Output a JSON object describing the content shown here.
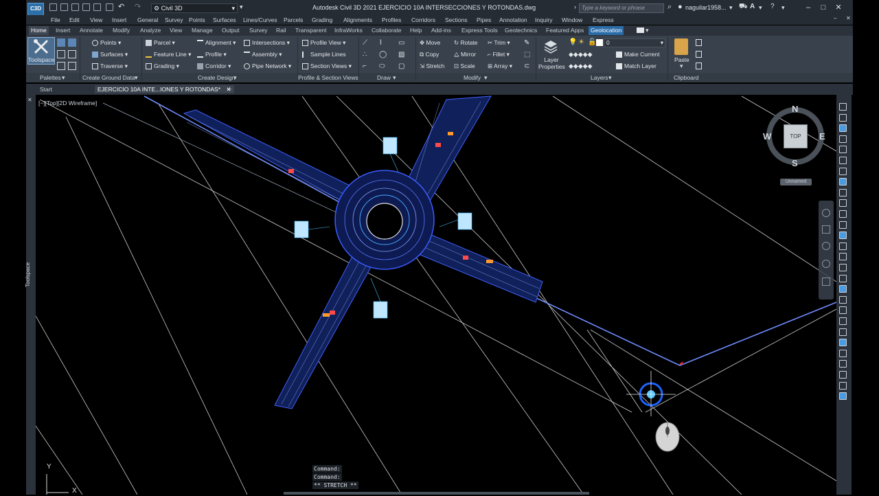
{
  "app": {
    "logo_text": "C3D",
    "title": "Autodesk Civil 3D 2021    EJERCICIO 10A INTERSECCIONES Y ROTONDAS.dwg",
    "workspace": "Civil 3D",
    "search_placeholder": "Type a keyword or phrase",
    "user": "naguilar1958..."
  },
  "menu": [
    "File",
    "Edit",
    "View",
    "Insert",
    "General",
    "Survey",
    "Points",
    "Surfaces",
    "Lines/Curves",
    "Parcels",
    "Grading",
    "Alignments",
    "Profiles",
    "Corridors",
    "Sections",
    "Pipes",
    "Annotation",
    "Inquiry",
    "Window",
    "Express"
  ],
  "ribbon_tabs": [
    "Home",
    "Insert",
    "Annotate",
    "Modify",
    "Analyze",
    "View",
    "Manage",
    "Output",
    "Survey",
    "Rail",
    "Transparent",
    "InfraWorks",
    "Collaborate",
    "Help",
    "Add-ins",
    "Express Tools",
    "Geotechnics",
    "Featured Apps",
    "Geolocation"
  ],
  "ribbon": {
    "toolspace": "Toolspace",
    "ground": {
      "points": "Points",
      "surfaces": "Surfaces",
      "traverse": "Traverse"
    },
    "design_a": {
      "parcel": "Parcel",
      "feature_line": "Feature Line",
      "grading": "Grading"
    },
    "design_b": {
      "alignment": "Alignment",
      "profile": "Profile",
      "corridor": "Corridor"
    },
    "design_c": {
      "intersections": "Intersections",
      "assembly": "Assembly",
      "pipe_network": "Pipe Network"
    },
    "profile_section": {
      "profile_view": "Profile View",
      "sample_lines": "Sample Lines",
      "section_views": "Section Views"
    },
    "modify": {
      "move": "Move",
      "copy": "Copy",
      "stretch": "Stretch",
      "rotate": "Rotate",
      "mirror": "Mirror",
      "scale": "Scale",
      "trim": "Trim",
      "fillet": "Fillet",
      "array": "Array"
    },
    "layers": {
      "layer_properties": "Layer Properties",
      "current_layer": "0",
      "make_current": "Make Current",
      "match_layer": "Match Layer"
    },
    "clipboard": {
      "paste": "Paste"
    },
    "panels": [
      "Palettes",
      "Create Ground Data",
      "Create Design",
      "Profile & Section Views",
      "Draw",
      "Modify",
      "Layers",
      "Clipboard"
    ]
  },
  "doc_tabs": [
    "Start",
    "EJERCICIO 10A INTE...IONES Y ROTONDAS*"
  ],
  "viewport": {
    "label": "[−][Top][2D Wireframe]",
    "viewcube": {
      "face": "TOP",
      "n": "N",
      "s": "S",
      "e": "E",
      "w": "W",
      "name": "Unnamed"
    },
    "ucs": {
      "x": "X",
      "y": "Y"
    }
  },
  "side": {
    "toolspace_label": "Toolspace"
  },
  "command": {
    "lines": [
      "Command:",
      "Command:",
      "** STRETCH **"
    ]
  }
}
